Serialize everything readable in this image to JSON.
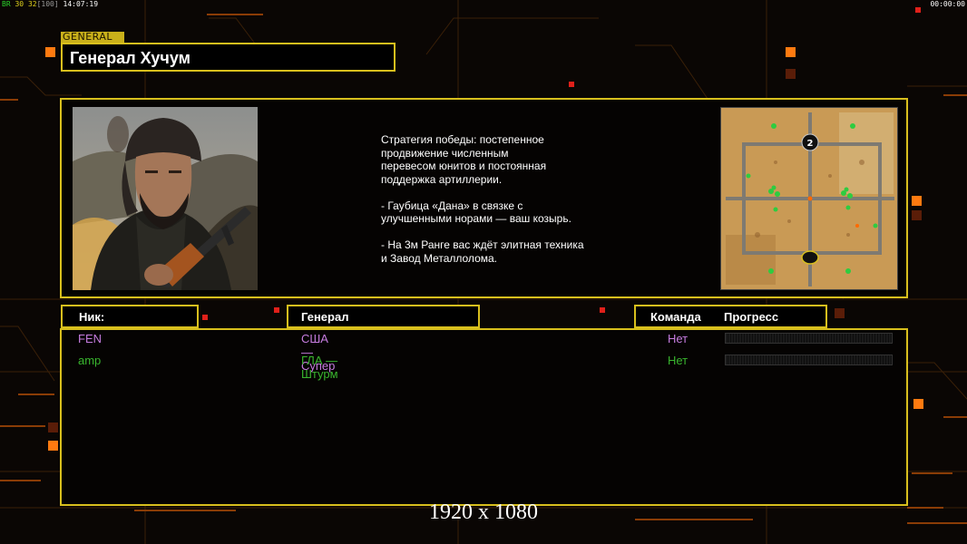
{
  "hud": {
    "fps_label": "BR",
    "fps_value": "30",
    "fps_target": "32",
    "fps_cap": "[100]",
    "clock_left": "14:07:19",
    "clock_right": "00:00:00"
  },
  "general": {
    "tag": "GENERAL",
    "name": "Генерал Хучум",
    "description": [
      "Стратегия победы: постепенное продвижение численным перевесом юнитов и постоянная поддержка артиллерии.",
      "- Гаубица «Дана» в связке с улучшенными норами — ваш козырь.",
      "- На 3м Ранге вас ждёт элитная техника и Завод Металлолома."
    ],
    "description_lines": [
      [
        "Стратегия победы: постепенное",
        "продвижение численным",
        "перевесом юнитов и постоянная",
        "поддержка артиллерии."
      ],
      [
        "- Гаубица «Дана» в связке с",
        "улучшенными норами — ваш козырь."
      ],
      [
        "- На 3м Ранге вас ждёт элитная техника",
        "и Завод Металлолома."
      ]
    ]
  },
  "minimap": {
    "start_marker": "2"
  },
  "table": {
    "col_nick": "Ник:",
    "col_general": "Генерал",
    "col_team": "Команда",
    "col_progress": "Прогресс"
  },
  "players": [
    {
      "nick": "FEN",
      "general": "США — Супер",
      "team": "Нет",
      "color": "#c77de0",
      "progress": 0
    },
    {
      "nick": "amp",
      "general": "ГЛА — Штурм",
      "team": "Нет",
      "color": "#39b52e",
      "progress": 0
    }
  ],
  "resolution": "1920 x 1080",
  "colors": {
    "frame": "#d8bf1d",
    "accent_orange": "#ff7a10",
    "accent_red": "#e0201a"
  }
}
